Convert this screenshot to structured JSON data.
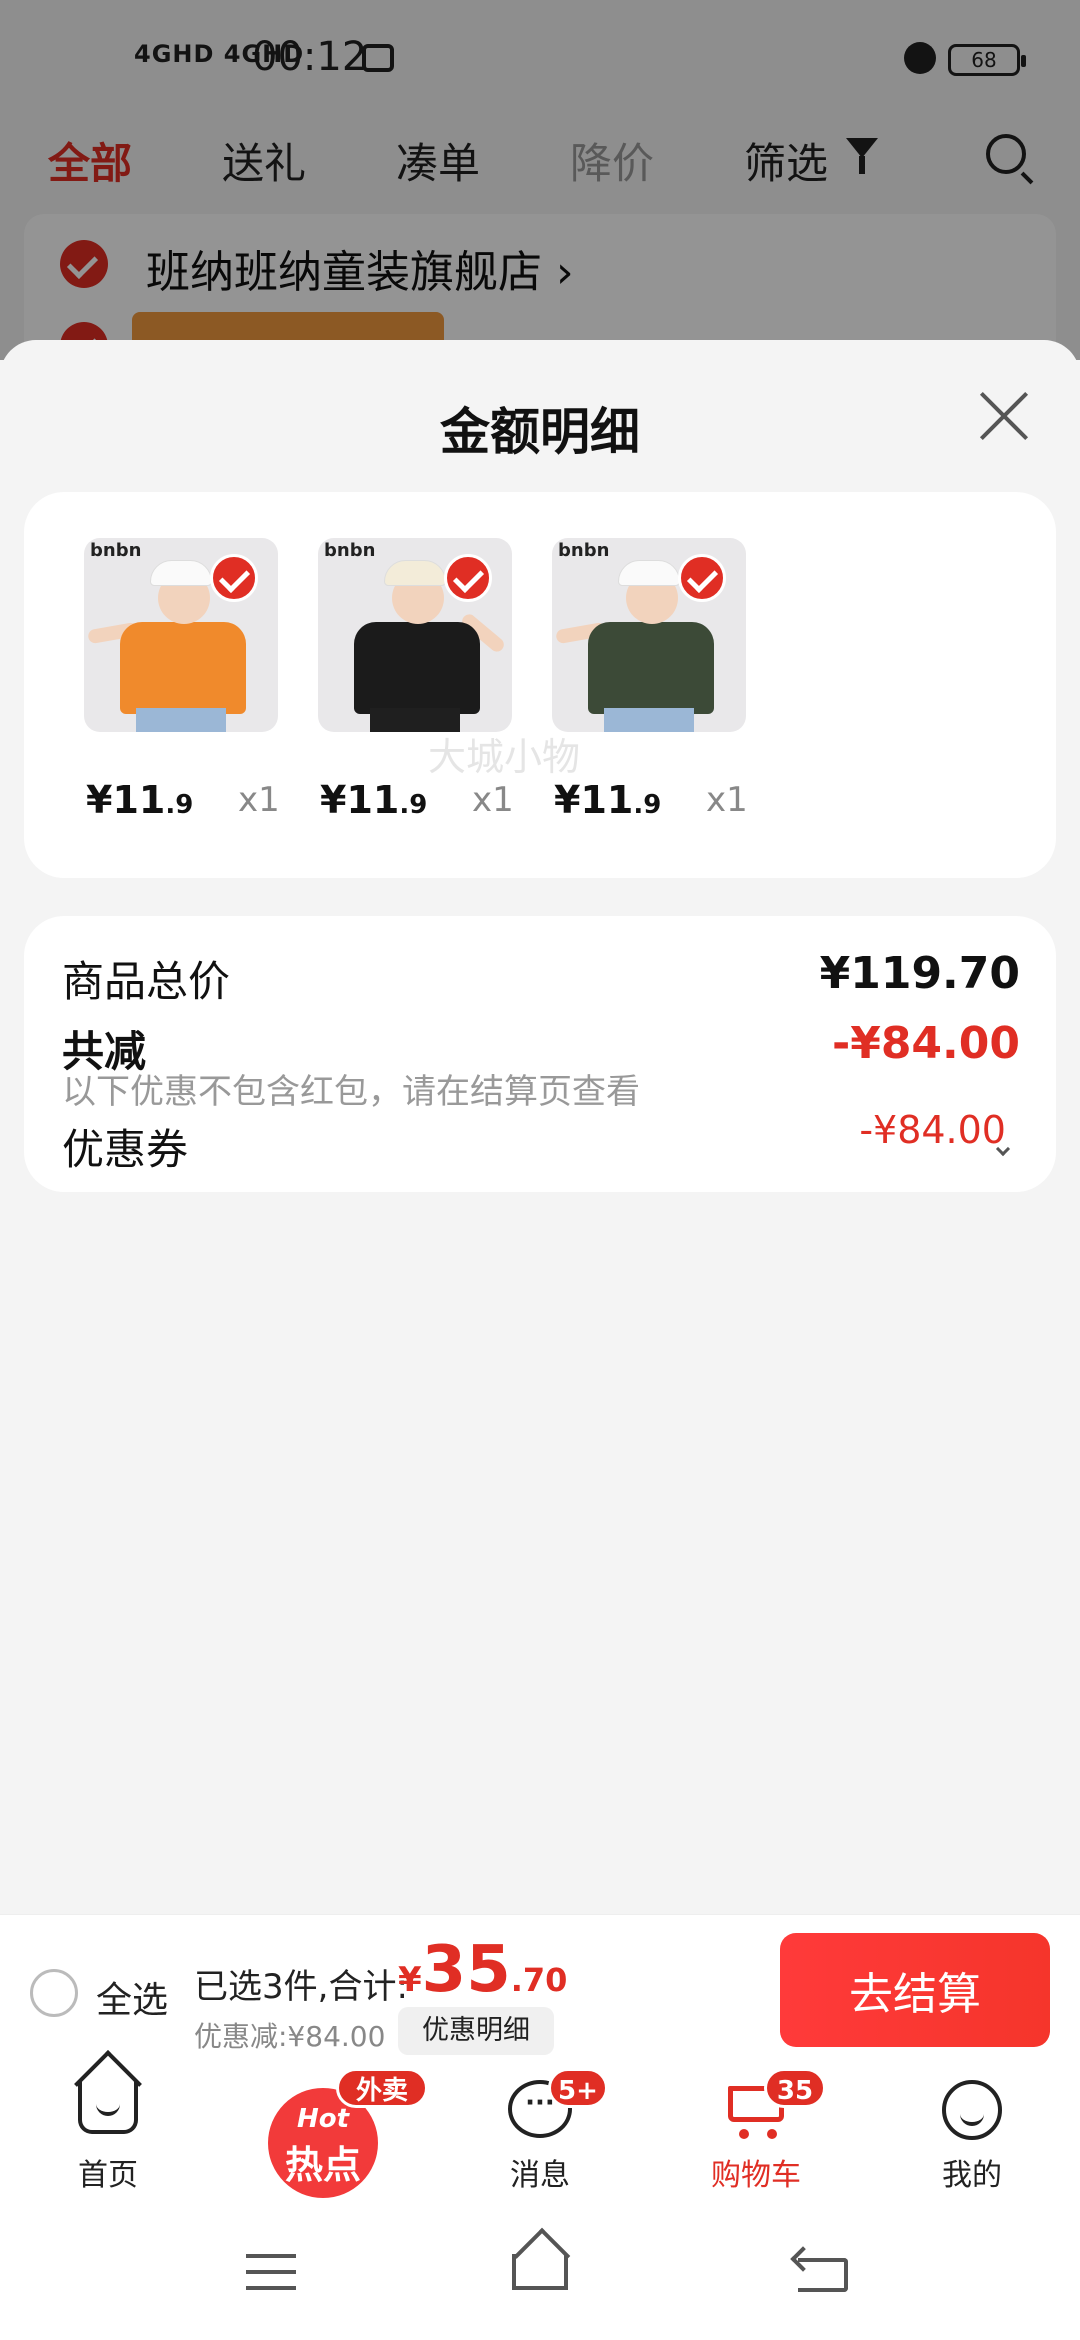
{
  "status_bar": {
    "signal": "4GHD 4GHD",
    "time": "00:12",
    "battery": "68"
  },
  "top_tabs": [
    {
      "label": "全部"
    },
    {
      "label": "送礼"
    },
    {
      "label": "凑单"
    },
    {
      "label": "降价"
    },
    {
      "label": "筛选"
    }
  ],
  "store": {
    "name": "班纳班纳童装旗舰店 ›"
  },
  "sheet": {
    "title": "金额明细",
    "items": [
      {
        "brand": "bnbn",
        "price_int": "¥11",
        "price_dec": ".9",
        "qty": "x1",
        "shirt_color": "#f08a2c"
      },
      {
        "brand": "bnbn",
        "price_int": "¥11",
        "price_dec": ".9",
        "qty": "x1",
        "shirt_color": "#1b1b1b"
      },
      {
        "brand": "bnbn",
        "price_int": "¥11",
        "price_dec": ".9",
        "qty": "x1",
        "shirt_color": "#3c4a37"
      }
    ],
    "summary": {
      "total_label": "商品总价",
      "total_value": "¥119.70",
      "reduce_label": "共减",
      "reduce_value": "-¥84.00",
      "reduce_note": "以下优惠不包含红包，请在结算页查看",
      "coupon_label": "优惠券",
      "coupon_value": "-¥84.00"
    },
    "watermark": "大城小物"
  },
  "checkout": {
    "select_all": "全选",
    "selected_text": "已选3件,合计:",
    "total_currency": "¥",
    "total_int": "35",
    "total_dec": ".70",
    "discount_text": "优惠减:¥84.00",
    "detail_chip": "优惠明细",
    "checkout_button": "去结算"
  },
  "tabbar": {
    "home": "首页",
    "hot_en": "Hot",
    "hot_cn": "热点",
    "hot_badge": "外卖",
    "messages": "消息",
    "messages_badge": "5+",
    "cart": "购物车",
    "cart_badge": "35",
    "me": "我的"
  },
  "colors": {
    "accent": "#e02e24",
    "checkout_button": "#f5352b"
  }
}
